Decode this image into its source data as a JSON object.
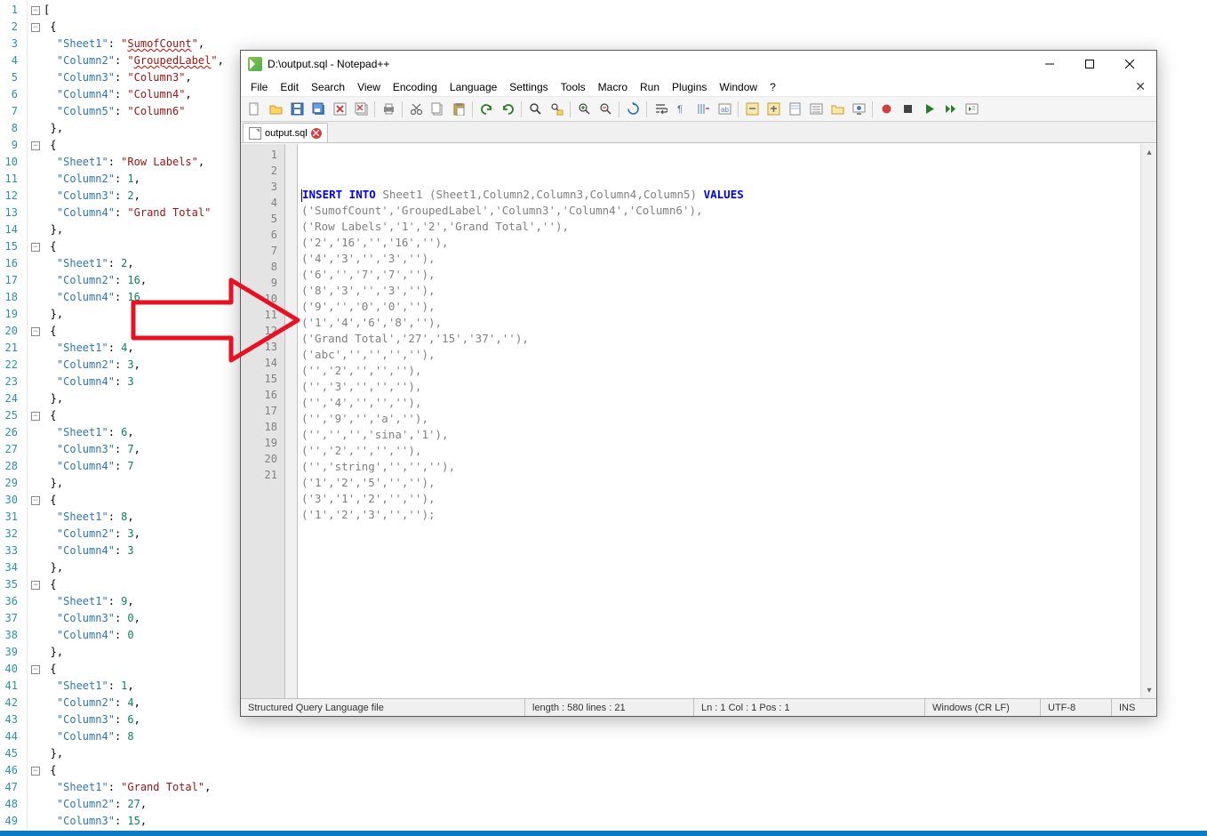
{
  "left_editor": {
    "lines": [
      {
        "n": 1,
        "segs": [
          {
            "t": "[",
            "c": "jpunc"
          }
        ],
        "fold": "open"
      },
      {
        "n": 2,
        "segs": [
          {
            "t": " {",
            "c": "jpunc"
          }
        ],
        "indent": 1,
        "fold": "open"
      },
      {
        "n": 3,
        "segs": [
          {
            "t": "  \"Sheet1\"",
            "c": "jkey"
          },
          {
            "t": ": ",
            "c": "jpunc"
          },
          {
            "t": "\"",
            "c": "jstr"
          },
          {
            "t": "SumofCount",
            "c": "jstr",
            "sq": 1
          },
          {
            "t": "\"",
            "c": "jstr"
          },
          {
            "t": ",",
            "c": "jpunc"
          }
        ]
      },
      {
        "n": 4,
        "segs": [
          {
            "t": "  \"Column2\"",
            "c": "jkey"
          },
          {
            "t": ": ",
            "c": "jpunc"
          },
          {
            "t": "\"",
            "c": "jstr"
          },
          {
            "t": "GroupedLabel",
            "c": "jstr",
            "sq": 1
          },
          {
            "t": "\"",
            "c": "jstr"
          },
          {
            "t": ",",
            "c": "jpunc"
          }
        ]
      },
      {
        "n": 5,
        "segs": [
          {
            "t": "  \"Column3\"",
            "c": "jkey"
          },
          {
            "t": ": ",
            "c": "jpunc"
          },
          {
            "t": "\"Column3\"",
            "c": "jstr"
          },
          {
            "t": ",",
            "c": "jpunc"
          }
        ]
      },
      {
        "n": 6,
        "segs": [
          {
            "t": "  \"Column4\"",
            "c": "jkey"
          },
          {
            "t": ": ",
            "c": "jpunc"
          },
          {
            "t": "\"Column4\"",
            "c": "jstr"
          },
          {
            "t": ",",
            "c": "jpunc"
          }
        ]
      },
      {
        "n": 7,
        "segs": [
          {
            "t": "  \"Column5\"",
            "c": "jkey"
          },
          {
            "t": ": ",
            "c": "jpunc"
          },
          {
            "t": "\"Column6\"",
            "c": "jstr"
          }
        ]
      },
      {
        "n": 8,
        "segs": [
          {
            "t": " },",
            "c": "jpunc"
          }
        ]
      },
      {
        "n": 9,
        "segs": [
          {
            "t": " {",
            "c": "jpunc"
          }
        ],
        "fold": "open"
      },
      {
        "n": 10,
        "segs": [
          {
            "t": "  \"Sheet1\"",
            "c": "jkey"
          },
          {
            "t": ": ",
            "c": "jpunc"
          },
          {
            "t": "\"Row Labels\"",
            "c": "jstr"
          },
          {
            "t": ",",
            "c": "jpunc"
          }
        ]
      },
      {
        "n": 11,
        "segs": [
          {
            "t": "  \"Column2\"",
            "c": "jkey"
          },
          {
            "t": ": ",
            "c": "jpunc"
          },
          {
            "t": "1",
            "c": "jnum"
          },
          {
            "t": ",",
            "c": "jpunc"
          }
        ]
      },
      {
        "n": 12,
        "segs": [
          {
            "t": "  \"Column3\"",
            "c": "jkey"
          },
          {
            "t": ": ",
            "c": "jpunc"
          },
          {
            "t": "2",
            "c": "jnum"
          },
          {
            "t": ",",
            "c": "jpunc"
          }
        ]
      },
      {
        "n": 13,
        "segs": [
          {
            "t": "  \"Column4\"",
            "c": "jkey"
          },
          {
            "t": ": ",
            "c": "jpunc"
          },
          {
            "t": "\"Grand Total\"",
            "c": "jstr"
          }
        ]
      },
      {
        "n": 14,
        "segs": [
          {
            "t": " },",
            "c": "jpunc"
          }
        ]
      },
      {
        "n": 15,
        "segs": [
          {
            "t": " {",
            "c": "jpunc"
          }
        ],
        "fold": "open"
      },
      {
        "n": 16,
        "segs": [
          {
            "t": "  \"Sheet1\"",
            "c": "jkey"
          },
          {
            "t": ": ",
            "c": "jpunc"
          },
          {
            "t": "2",
            "c": "jnum"
          },
          {
            "t": ",",
            "c": "jpunc"
          }
        ]
      },
      {
        "n": 17,
        "segs": [
          {
            "t": "  \"Column2\"",
            "c": "jkey"
          },
          {
            "t": ": ",
            "c": "jpunc"
          },
          {
            "t": "16",
            "c": "jnum"
          },
          {
            "t": ",",
            "c": "jpunc"
          }
        ]
      },
      {
        "n": 18,
        "segs": [
          {
            "t": "  \"Column4\"",
            "c": "jkey"
          },
          {
            "t": ": ",
            "c": "jpunc"
          },
          {
            "t": "16",
            "c": "jnum"
          }
        ]
      },
      {
        "n": 19,
        "segs": [
          {
            "t": " },",
            "c": "jpunc"
          }
        ]
      },
      {
        "n": 20,
        "segs": [
          {
            "t": " {",
            "c": "jpunc"
          }
        ],
        "fold": "open"
      },
      {
        "n": 21,
        "segs": [
          {
            "t": "  \"Sheet1\"",
            "c": "jkey"
          },
          {
            "t": ": ",
            "c": "jpunc"
          },
          {
            "t": "4",
            "c": "jnum"
          },
          {
            "t": ",",
            "c": "jpunc"
          }
        ]
      },
      {
        "n": 22,
        "segs": [
          {
            "t": "  \"Column2\"",
            "c": "jkey"
          },
          {
            "t": ": ",
            "c": "jpunc"
          },
          {
            "t": "3",
            "c": "jnum"
          },
          {
            "t": ",",
            "c": "jpunc"
          }
        ]
      },
      {
        "n": 23,
        "segs": [
          {
            "t": "  \"Column4\"",
            "c": "jkey"
          },
          {
            "t": ": ",
            "c": "jpunc"
          },
          {
            "t": "3",
            "c": "jnum"
          }
        ]
      },
      {
        "n": 24,
        "segs": [
          {
            "t": " },",
            "c": "jpunc"
          }
        ]
      },
      {
        "n": 25,
        "segs": [
          {
            "t": " {",
            "c": "jpunc"
          }
        ],
        "fold": "open"
      },
      {
        "n": 26,
        "segs": [
          {
            "t": "  \"Sheet1\"",
            "c": "jkey"
          },
          {
            "t": ": ",
            "c": "jpunc"
          },
          {
            "t": "6",
            "c": "jnum"
          },
          {
            "t": ",",
            "c": "jpunc"
          }
        ]
      },
      {
        "n": 27,
        "segs": [
          {
            "t": "  \"Column3\"",
            "c": "jkey"
          },
          {
            "t": ": ",
            "c": "jpunc"
          },
          {
            "t": "7",
            "c": "jnum"
          },
          {
            "t": ",",
            "c": "jpunc"
          }
        ]
      },
      {
        "n": 28,
        "segs": [
          {
            "t": "  \"Column4\"",
            "c": "jkey"
          },
          {
            "t": ": ",
            "c": "jpunc"
          },
          {
            "t": "7",
            "c": "jnum"
          }
        ]
      },
      {
        "n": 29,
        "segs": [
          {
            "t": " },",
            "c": "jpunc"
          }
        ]
      },
      {
        "n": 30,
        "segs": [
          {
            "t": " {",
            "c": "jpunc"
          }
        ],
        "fold": "open"
      },
      {
        "n": 31,
        "segs": [
          {
            "t": "  \"Sheet1\"",
            "c": "jkey"
          },
          {
            "t": ": ",
            "c": "jpunc"
          },
          {
            "t": "8",
            "c": "jnum"
          },
          {
            "t": ",",
            "c": "jpunc"
          }
        ]
      },
      {
        "n": 32,
        "segs": [
          {
            "t": "  \"Column2\"",
            "c": "jkey"
          },
          {
            "t": ": ",
            "c": "jpunc"
          },
          {
            "t": "3",
            "c": "jnum"
          },
          {
            "t": ",",
            "c": "jpunc"
          }
        ]
      },
      {
        "n": 33,
        "segs": [
          {
            "t": "  \"Column4\"",
            "c": "jkey"
          },
          {
            "t": ": ",
            "c": "jpunc"
          },
          {
            "t": "3",
            "c": "jnum"
          }
        ]
      },
      {
        "n": 34,
        "segs": [
          {
            "t": " },",
            "c": "jpunc"
          }
        ]
      },
      {
        "n": 35,
        "segs": [
          {
            "t": " {",
            "c": "jpunc"
          }
        ],
        "fold": "open"
      },
      {
        "n": 36,
        "segs": [
          {
            "t": "  \"Sheet1\"",
            "c": "jkey"
          },
          {
            "t": ": ",
            "c": "jpunc"
          },
          {
            "t": "9",
            "c": "jnum"
          },
          {
            "t": ",",
            "c": "jpunc"
          }
        ]
      },
      {
        "n": 37,
        "segs": [
          {
            "t": "  \"Column3\"",
            "c": "jkey"
          },
          {
            "t": ": ",
            "c": "jpunc"
          },
          {
            "t": "0",
            "c": "jnum"
          },
          {
            "t": ",",
            "c": "jpunc"
          }
        ]
      },
      {
        "n": 38,
        "segs": [
          {
            "t": "  \"Column4\"",
            "c": "jkey"
          },
          {
            "t": ": ",
            "c": "jpunc"
          },
          {
            "t": "0",
            "c": "jnum"
          }
        ]
      },
      {
        "n": 39,
        "segs": [
          {
            "t": " },",
            "c": "jpunc"
          }
        ]
      },
      {
        "n": 40,
        "segs": [
          {
            "t": " {",
            "c": "jpunc"
          }
        ],
        "fold": "open"
      },
      {
        "n": 41,
        "segs": [
          {
            "t": "  \"Sheet1\"",
            "c": "jkey"
          },
          {
            "t": ": ",
            "c": "jpunc"
          },
          {
            "t": "1",
            "c": "jnum"
          },
          {
            "t": ",",
            "c": "jpunc"
          }
        ]
      },
      {
        "n": 42,
        "segs": [
          {
            "t": "  \"Column2\"",
            "c": "jkey"
          },
          {
            "t": ": ",
            "c": "jpunc"
          },
          {
            "t": "4",
            "c": "jnum"
          },
          {
            "t": ",",
            "c": "jpunc"
          }
        ]
      },
      {
        "n": 43,
        "segs": [
          {
            "t": "  \"Column3\"",
            "c": "jkey"
          },
          {
            "t": ": ",
            "c": "jpunc"
          },
          {
            "t": "6",
            "c": "jnum"
          },
          {
            "t": ",",
            "c": "jpunc"
          }
        ]
      },
      {
        "n": 44,
        "segs": [
          {
            "t": "  \"Column4\"",
            "c": "jkey"
          },
          {
            "t": ": ",
            "c": "jpunc"
          },
          {
            "t": "8",
            "c": "jnum"
          }
        ]
      },
      {
        "n": 45,
        "segs": [
          {
            "t": " },",
            "c": "jpunc"
          }
        ]
      },
      {
        "n": 46,
        "segs": [
          {
            "t": " {",
            "c": "jpunc"
          }
        ],
        "fold": "open"
      },
      {
        "n": 47,
        "segs": [
          {
            "t": "  \"Sheet1\"",
            "c": "jkey"
          },
          {
            "t": ": ",
            "c": "jpunc"
          },
          {
            "t": "\"Grand Total\"",
            "c": "jstr"
          },
          {
            "t": ",",
            "c": "jpunc"
          }
        ]
      },
      {
        "n": 48,
        "segs": [
          {
            "t": "  \"Column2\"",
            "c": "jkey"
          },
          {
            "t": ": ",
            "c": "jpunc"
          },
          {
            "t": "27",
            "c": "jnum"
          },
          {
            "t": ",",
            "c": "jpunc"
          }
        ]
      },
      {
        "n": 49,
        "segs": [
          {
            "t": "  \"Column3\"",
            "c": "jkey"
          },
          {
            "t": ": ",
            "c": "jpunc"
          },
          {
            "t": "15",
            "c": "jnum"
          },
          {
            "t": ",",
            "c": "jpunc"
          }
        ]
      }
    ]
  },
  "npp": {
    "title": "D:\\output.sql - Notepad++",
    "menus": [
      "File",
      "Edit",
      "Search",
      "View",
      "Encoding",
      "Language",
      "Settings",
      "Tools",
      "Macro",
      "Run",
      "Plugins",
      "Window",
      "?"
    ],
    "tab": {
      "label": "output.sql"
    },
    "code_lines": [
      {
        "n": 1,
        "segs": [
          {
            "t": "INSERT INTO",
            "c": "kw",
            "caret_before": true
          },
          {
            "t": " Sheet1 ",
            "c": "gray"
          },
          {
            "t": "(",
            "c": "gray"
          },
          {
            "t": "Sheet1,Column2,Column3,Column4,Column5",
            "c": "gray"
          },
          {
            "t": ") ",
            "c": "gray"
          },
          {
            "t": "VALUES",
            "c": "kw"
          }
        ]
      },
      {
        "n": 2,
        "segs": [
          {
            "t": "('SumofCount','GroupedLabel','Column3','Column4','Column6'),",
            "c": "gray"
          }
        ]
      },
      {
        "n": 3,
        "segs": [
          {
            "t": "('Row Labels','1','2','Grand Total',''),",
            "c": "gray"
          }
        ]
      },
      {
        "n": 4,
        "segs": [
          {
            "t": "('2','16','','16',''),",
            "c": "gray"
          }
        ]
      },
      {
        "n": 5,
        "segs": [
          {
            "t": "('4','3','','3',''),",
            "c": "gray"
          }
        ]
      },
      {
        "n": 6,
        "segs": [
          {
            "t": "('6','','7','7',''),",
            "c": "gray"
          }
        ]
      },
      {
        "n": 7,
        "segs": [
          {
            "t": "('8','3','','3',''),",
            "c": "gray"
          }
        ]
      },
      {
        "n": 8,
        "segs": [
          {
            "t": "('9','','0','0',''),",
            "c": "gray"
          }
        ]
      },
      {
        "n": 9,
        "segs": [
          {
            "t": "('1','4','6','8',''),",
            "c": "gray"
          }
        ]
      },
      {
        "n": 10,
        "segs": [
          {
            "t": "('Grand Total','27','15','37',''),",
            "c": "gray"
          }
        ]
      },
      {
        "n": 11,
        "segs": [
          {
            "t": "('abc','','','',''),",
            "c": "gray"
          }
        ]
      },
      {
        "n": 12,
        "segs": [
          {
            "t": "('','2','','',''),",
            "c": "gray"
          }
        ]
      },
      {
        "n": 13,
        "segs": [
          {
            "t": "('','3','','',''),",
            "c": "gray"
          }
        ]
      },
      {
        "n": 14,
        "segs": [
          {
            "t": "('','4','','',''),",
            "c": "gray"
          }
        ]
      },
      {
        "n": 15,
        "segs": [
          {
            "t": "('','9','','a',''),",
            "c": "gray"
          }
        ]
      },
      {
        "n": 16,
        "segs": [
          {
            "t": "('','','','sina','1'),",
            "c": "gray"
          }
        ]
      },
      {
        "n": 17,
        "segs": [
          {
            "t": "('','2','','',''),",
            "c": "gray"
          }
        ]
      },
      {
        "n": 18,
        "segs": [
          {
            "t": "('','string','','',''),",
            "c": "gray"
          }
        ]
      },
      {
        "n": 19,
        "segs": [
          {
            "t": "('1','2','5','',''),",
            "c": "gray"
          }
        ]
      },
      {
        "n": 20,
        "segs": [
          {
            "t": "('3','1','2','',''),",
            "c": "gray"
          }
        ]
      },
      {
        "n": 21,
        "segs": [
          {
            "t": "('1','2','3','','');",
            "c": "gray"
          }
        ]
      }
    ],
    "status": {
      "filetype": "Structured Query Language file",
      "length": "length : 580   lines : 21",
      "pos": "Ln : 1   Col : 1   Pos : 1",
      "eol": "Windows (CR LF)",
      "enc": "UTF-8",
      "ins": "INS"
    }
  },
  "toolbar_icons": [
    "new",
    "open",
    "save",
    "save-all",
    "close",
    "close-all",
    "print",
    "cut",
    "copy",
    "paste",
    "undo",
    "redo",
    "find",
    "replace",
    "zoom-in",
    "zoom-out",
    "sync",
    "wrap",
    "show-all",
    "indent-guide",
    "lang",
    "fold",
    "unfold",
    "doc-map",
    "func-list",
    "folder",
    "monitor",
    "record",
    "stop",
    "play",
    "fast",
    "run-dialog"
  ]
}
